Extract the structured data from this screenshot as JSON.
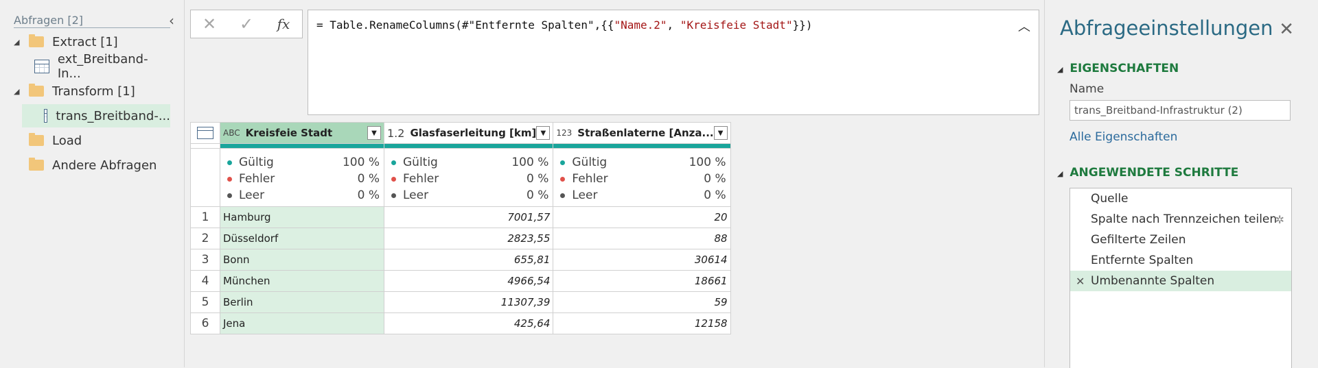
{
  "queries": {
    "title": "Abfragen [2]",
    "collapse_icon": "chevron-left-icon",
    "items": [
      {
        "type": "group",
        "label": "Extract [1]",
        "expanded": true
      },
      {
        "type": "query",
        "label": "ext_Breitband-In..."
      },
      {
        "type": "group",
        "label": "Transform [1]",
        "expanded": true
      },
      {
        "type": "query",
        "label": "trans_Breitband-...",
        "selected": true
      },
      {
        "type": "group",
        "label": "Load"
      },
      {
        "type": "group",
        "label": "Andere Abfragen"
      }
    ]
  },
  "formula_bar": {
    "cancel_glyph": "✕",
    "commit_glyph": "✓",
    "fx_label": "fx",
    "formula_prefix": "= Table.RenameColumns(#\"Entfernte Spalten\",{{",
    "str1": "\"Name.2\"",
    "sep": ", ",
    "str2": "\"Kreisfeie Stadt\"",
    "formula_suffix": "}})"
  },
  "grid": {
    "columns": [
      {
        "type_label": "ABC",
        "name": "Kreisfeie Stadt",
        "selected": true
      },
      {
        "type_label": "1.2",
        "name": "Glasfaserleitung [km]"
      },
      {
        "type_label": "123",
        "name": "Straßenlaterne [Anza..."
      }
    ],
    "quality": [
      {
        "valid_label": "Gültig",
        "valid": "100 %",
        "error_label": "Fehler",
        "error": "0 %",
        "empty_label": "Leer",
        "empty": "0 %"
      },
      {
        "valid_label": "Gültig",
        "valid": "100 %",
        "error_label": "Fehler",
        "error": "0 %",
        "empty_label": "Leer",
        "empty": "0 %"
      },
      {
        "valid_label": "Gültig",
        "valid": "100 %",
        "error_label": "Fehler",
        "error": "0 %",
        "empty_label": "Leer",
        "empty": "0 %"
      }
    ],
    "rows": [
      {
        "idx": "1",
        "city": "Hamburg",
        "glas": "7001,57",
        "laterne": "20"
      },
      {
        "idx": "2",
        "city": "Düsseldorf",
        "glas": "2823,55",
        "laterne": "88"
      },
      {
        "idx": "3",
        "city": "Bonn",
        "glas": "655,81",
        "laterne": "30614"
      },
      {
        "idx": "4",
        "city": "München",
        "glas": "4966,54",
        "laterne": "18661"
      },
      {
        "idx": "5",
        "city": "Berlin",
        "glas": "11307,39",
        "laterne": "59"
      },
      {
        "idx": "6",
        "city": "Jena",
        "glas": "425,64",
        "laterne": "12158"
      }
    ],
    "colors": {
      "valid": "#19a59b",
      "error": "#e0514a",
      "empty": "#555555"
    }
  },
  "settings": {
    "title": "Abfrageeinstellungen",
    "properties_header": "EIGENSCHAFTEN",
    "name_label": "Name",
    "name_value": "trans_Breitband-Infrastruktur (2)",
    "all_properties": "Alle Eigenschaften",
    "steps_header": "ANGEWENDETE SCHRITTE",
    "steps": [
      {
        "label": "Quelle"
      },
      {
        "label": "Spalte nach Trennzeichen teilen",
        "has_gear": true
      },
      {
        "label": "Gefilterte Zeilen"
      },
      {
        "label": "Entfernte Spalten"
      },
      {
        "label": "Umbenannte Spalten",
        "active": true
      }
    ]
  }
}
